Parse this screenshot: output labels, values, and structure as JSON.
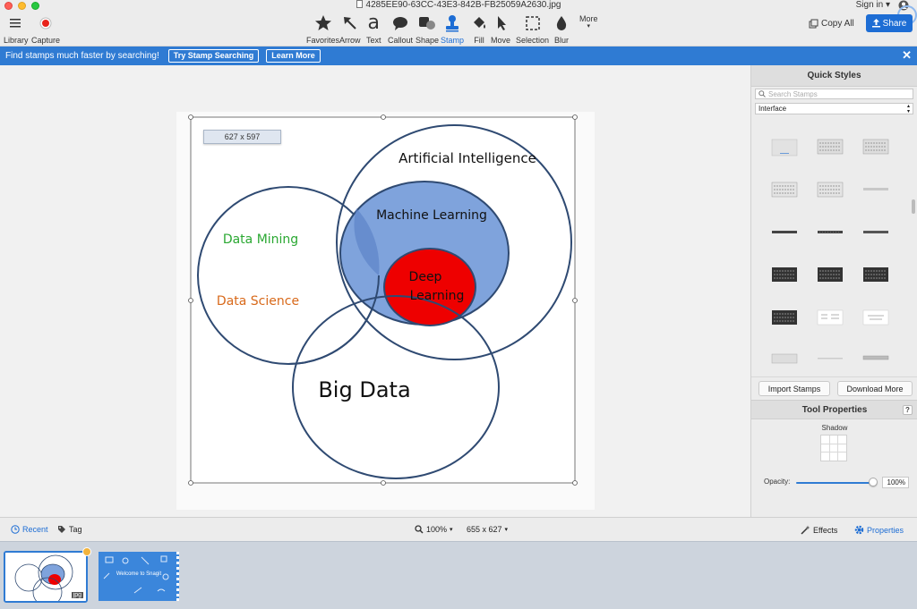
{
  "window": {
    "title": "4285EE90-63CC-43E3-842B-FB25059A2630.jpg",
    "sign_in": "Sign in"
  },
  "toolbar": {
    "library": "Library",
    "capture": "Capture",
    "tools": [
      {
        "label": "Favorites",
        "icon": "star-icon"
      },
      {
        "label": "Arrow",
        "icon": "arrow-icon"
      },
      {
        "label": "Text",
        "icon": "text-icon"
      },
      {
        "label": "Callout",
        "icon": "callout-icon"
      },
      {
        "label": "Shape",
        "icon": "shape-icon"
      },
      {
        "label": "Stamp",
        "icon": "stamp-icon"
      },
      {
        "label": "Fill",
        "icon": "fill-icon"
      },
      {
        "label": "Move",
        "icon": "move-icon"
      },
      {
        "label": "Selection",
        "icon": "selection-icon"
      },
      {
        "label": "Blur",
        "icon": "blur-icon"
      }
    ],
    "more": "More",
    "copy_all": "Copy All",
    "share": "Share"
  },
  "banner": {
    "message": "Find stamps much faster by searching!",
    "try_button": "Try Stamp Searching",
    "learn_button": "Learn More"
  },
  "canvas": {
    "size_label": "627 x 597",
    "venn": {
      "ai": "Artificial Intelligence",
      "ml": "Machine Learning",
      "dl_line1": "Deep",
      "dl_line2": "Learning",
      "data_mining": "Data Mining",
      "data_science": "Data Science",
      "big_data": "Big Data",
      "colors": {
        "ml_fill": "#7fa3dc",
        "dl_fill": "#ee0000",
        "stroke": "#2f4a72",
        "data_mining": "#2aa832",
        "data_science": "#d8691a"
      }
    }
  },
  "sidebar": {
    "quick_styles": "Quick Styles",
    "search_placeholder": "Search Stamps",
    "category": "Interface",
    "import": "Import Stamps",
    "download": "Download More",
    "tool_properties": "Tool Properties",
    "help": "?",
    "shadow": "Shadow",
    "opacity_label": "Opacity:",
    "opacity_value": "100%",
    "opacity_fraction": 1.0
  },
  "status": {
    "recent": "Recent",
    "tag": "Tag",
    "zoom": "100%",
    "dimensions": "655 x 627",
    "effects": "Effects",
    "properties": "Properties"
  },
  "tray": {
    "thumb1_tag": "jpg",
    "thumb2_title": "Welcome to Snagit"
  }
}
